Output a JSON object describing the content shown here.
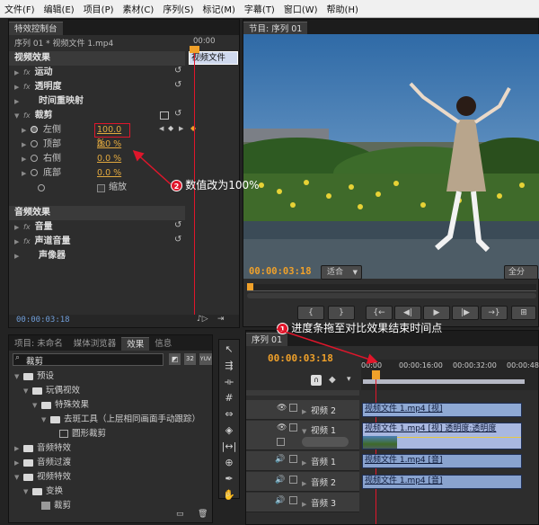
{
  "menu": [
    "文件(F)",
    "编辑(E)",
    "项目(P)",
    "素材(C)",
    "序列(S)",
    "标记(M)",
    "字幕(T)",
    "窗口(W)",
    "帮助(H)"
  ],
  "effect_controls": {
    "tab": "特效控制台",
    "sequence_label": "序列 01 * 视频文件 1.mp4",
    "time_ruler": "00:00",
    "clip_name": "视频文件",
    "video_effects": "视频效果",
    "audio_effects": "音频效果",
    "motion": "运动",
    "opacity": "透明度",
    "time_remap": "时间重映射",
    "crop": "裁剪",
    "params": [
      {
        "label": "左侧",
        "value": "100.0 %"
      },
      {
        "label": "顶部",
        "value": "0.0 %"
      },
      {
        "label": "右侧",
        "value": "0.0 %"
      },
      {
        "label": "底部",
        "value": "0.0 %"
      }
    ],
    "zoom": "缩放",
    "volume": "音量",
    "channel_volume": "声道音量",
    "panner": "声像器",
    "timecode": "00:00:03:18"
  },
  "program": {
    "tab": "节目: 序列 01",
    "timecode": "00:00:03:18",
    "fit": "适合",
    "full": "全分"
  },
  "project_tabs": [
    "项目: 未命名",
    "媒体浏览器",
    "效果",
    "信息"
  ],
  "effects_search": "裁剪",
  "effects_tree": [
    {
      "label": "预设",
      "level": 1
    },
    {
      "label": "玩偶视效",
      "level": 2
    },
    {
      "label": "特殊效果",
      "level": 3
    },
    {
      "label": "去斑工具（上层相同画面手动跟踪）",
      "level": 4
    },
    {
      "label": "圆形裁剪",
      "level": 5
    },
    {
      "label": "音频特效",
      "level": 1
    },
    {
      "label": "音频过渡",
      "level": 1
    },
    {
      "label": "视频特效",
      "level": 1
    },
    {
      "label": "变换",
      "level": 2
    },
    {
      "label": "裁剪",
      "level": 3
    }
  ],
  "timeline": {
    "tab": "序列 01",
    "timecode": "00:00:03:18",
    "ruler": [
      "00:00",
      "00:00:16:00",
      "00:00:32:00",
      "00:00:48:"
    ],
    "tracks": [
      {
        "name": "视频 2",
        "clip": "视频文件 1.mp4 [视]"
      },
      {
        "name": "视频 1",
        "clip": "视频文件 1.mp4 [视] 透明度:透明度"
      },
      {
        "name": "音频 1",
        "clip": "视频文件 1.mp4 [音]"
      },
      {
        "name": "音频 2",
        "clip": "视频文件 1.mp4 [音]"
      },
      {
        "name": "音频 3",
        "clip": ""
      }
    ]
  },
  "annotations": [
    {
      "num": "1",
      "text": "进度条拖至对比效果结束时间点"
    },
    {
      "num": "2",
      "text": "数值改为100%"
    }
  ],
  "colors": {
    "accent_orange": "#f0a12a",
    "callout_red": "#e0162b",
    "clip_blue": "#8fa9d4"
  }
}
